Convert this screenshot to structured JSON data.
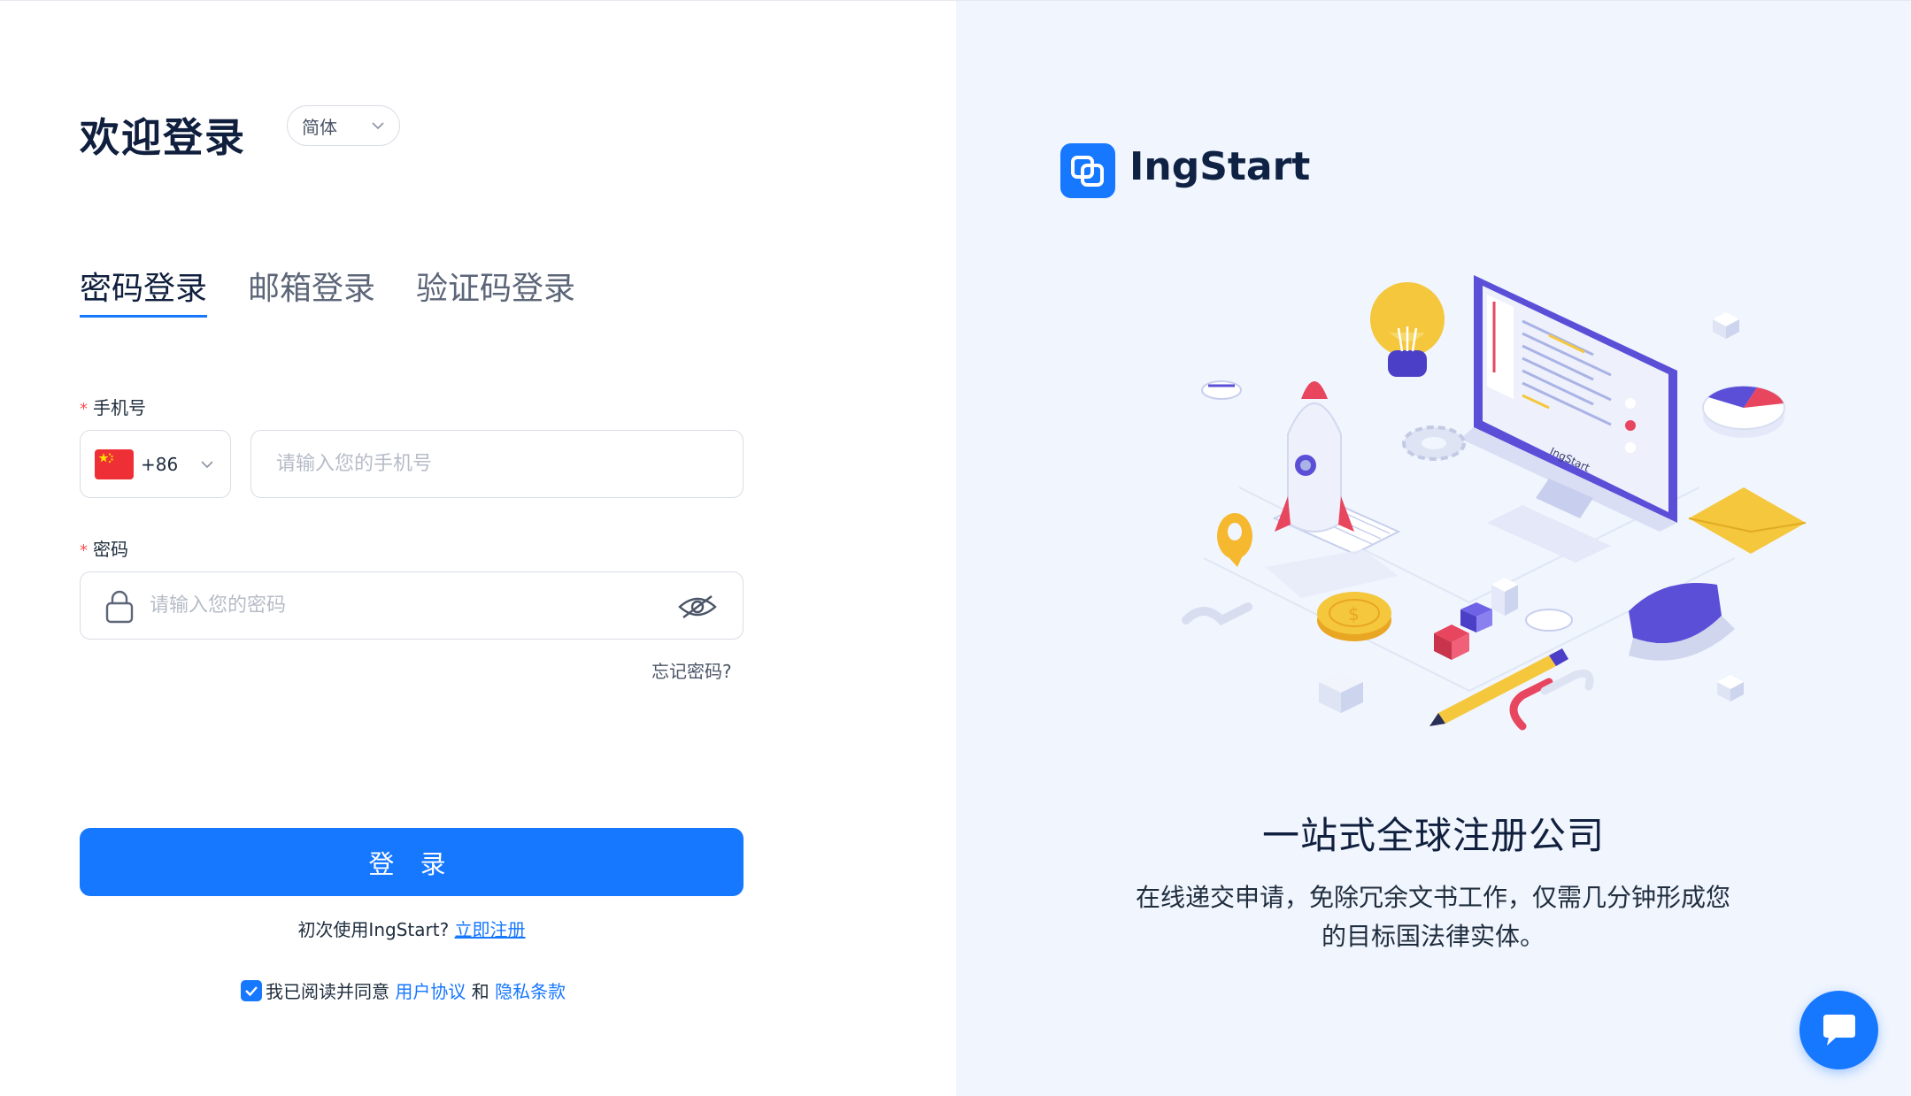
{
  "header": {
    "title": "欢迎登录",
    "language": "简体"
  },
  "tabs": [
    {
      "label": "密码登录",
      "active": true
    },
    {
      "label": "邮箱登录",
      "active": false
    },
    {
      "label": "验证码登录",
      "active": false
    }
  ],
  "form": {
    "phone_label": "手机号",
    "required_mark": "*",
    "country_code": "+86",
    "country_flag": "china-flag-icon",
    "phone_placeholder": "请输入您的手机号",
    "password_label": "密码",
    "password_placeholder": "请输入您的密码",
    "forgot_password": "忘记密码?",
    "login_button": "登 录"
  },
  "register": {
    "prompt": "初次使用IngStart?",
    "link": "立即注册"
  },
  "agreement": {
    "checked": true,
    "prefix": "我已阅读并同意",
    "user_agreement": "用户协议",
    "and": "和",
    "privacy": "隐私条款"
  },
  "promo": {
    "brand": "IngStart",
    "illustration_label": "IngStart",
    "title": "一站式全球注册公司",
    "description": "在线递交申请，免除冗余文书工作，仅需几分钟形成您的目标国法律实体。"
  },
  "colors": {
    "accent": "#1677ff",
    "right_bg": "#f0f5fe",
    "title": "#0f1f3d",
    "required": "#ff4d4f"
  },
  "icons": [
    "chevron-down-icon",
    "lock-icon",
    "eye-hidden-icon",
    "brand-logo-icon",
    "chat-icon",
    "check-icon"
  ]
}
